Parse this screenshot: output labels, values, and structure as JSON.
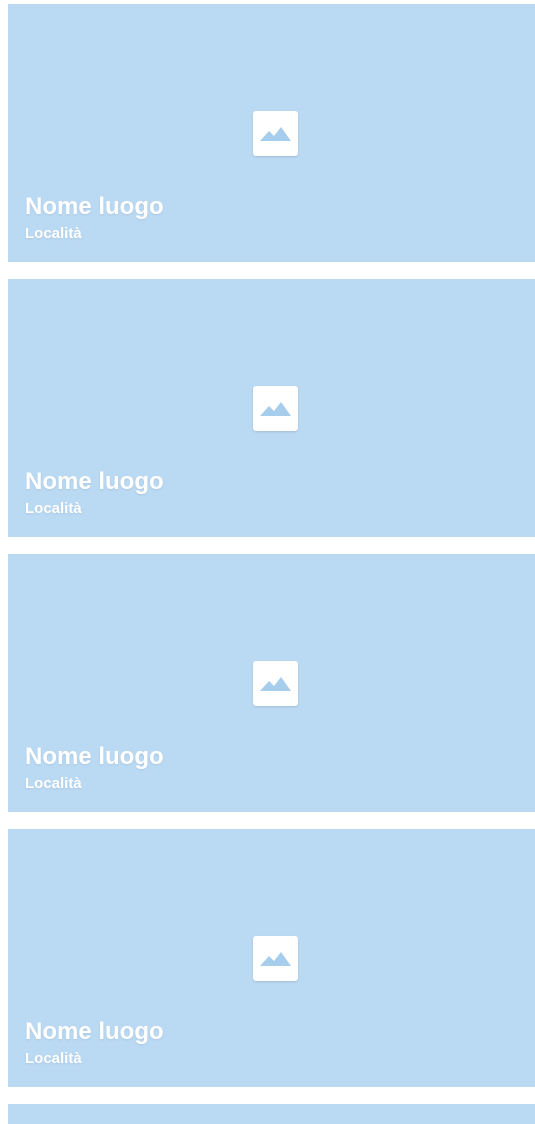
{
  "theme": {
    "card_bg": "#bad9f3",
    "icon_bg": "#ffffff",
    "icon_glyph": "#a6cdec",
    "text": "#ffffff"
  },
  "cards": [
    {
      "title": "Nome luogo",
      "subtitle": "Località",
      "icon": "image-placeholder-icon"
    },
    {
      "title": "Nome luogo",
      "subtitle": "Località",
      "icon": "image-placeholder-icon"
    },
    {
      "title": "Nome luogo",
      "subtitle": "Località",
      "icon": "image-placeholder-icon"
    },
    {
      "title": "Nome luogo",
      "subtitle": "Località",
      "icon": "image-placeholder-icon"
    }
  ]
}
